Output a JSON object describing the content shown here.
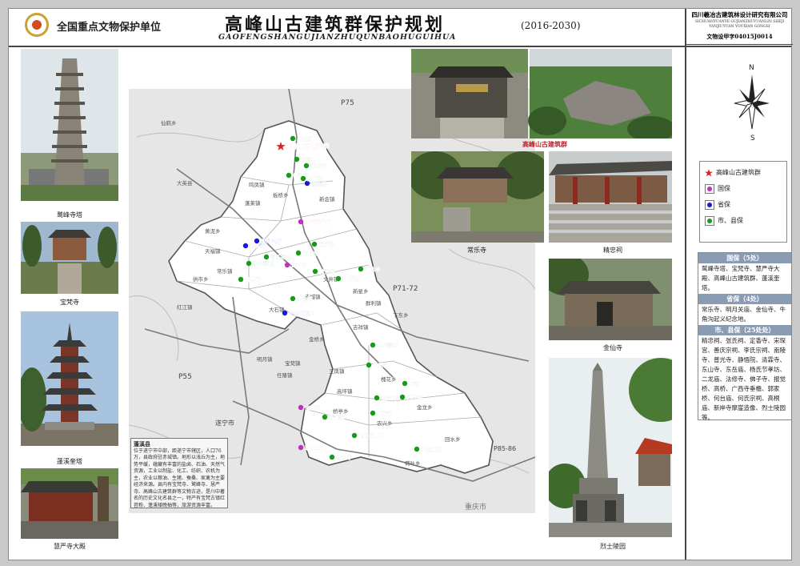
{
  "header": {
    "unit_label": "全国重点文物保护单位",
    "title": "高峰山古建筑群保护规划",
    "title_pinyin": "GAOFENGSHANGUJIANZHUQUNBAOHUGUIHUA",
    "years": "(2016-2030)"
  },
  "sidebar": {
    "org_name": "四川羲冶古建筑林设计研究有限公司",
    "org_name_en": "SICHUANYUANYE GUJIANZHUYUANLIN SHEJI YANJIUYUAN YOUXIAN GONGSI",
    "cert": "文物设甲字04015J0014",
    "compass_n": "N",
    "compass_s": "S",
    "legend": [
      {
        "label": "高峰山古建筑群",
        "color": "#e02020",
        "symbol": "star"
      },
      {
        "label": "国保",
        "color": "#c030c0",
        "symbol": "dot"
      },
      {
        "label": "省保",
        "color": "#1a1ad0",
        "symbol": "dot"
      },
      {
        "label": "市、县保",
        "color": "#1a9a1a",
        "symbol": "dot"
      }
    ],
    "lists": [
      {
        "heading": "国保（5处）",
        "body": "鹫峰寺塔、宝梵寺、慧严寺大殿、高峰山古建筑群、蓬溪奎塔。"
      },
      {
        "heading": "省保（4处）",
        "body": "常乐寺、明月关庙、金仙寺、牛角沟起义纪念地。"
      },
      {
        "heading": "市、县保（25处处）",
        "body": "精忠祠、张氏祠、定香寺、宋琛宫、善庆宗祠、李氏宗祠、南陵寺、普光寺、静悟院、清霖寺、东山寺、东岳庙、杨氏节孝坊、二龙庙、法修寺、佛子寺、报觉桥、高桥、广西寺垂檐、郭家桥、何台庙、何氏宗祠、高桐庙、新岸寺摩崖造像、烈士陵园等。"
      }
    ]
  },
  "photos": [
    {
      "name": "jiufeng-tower",
      "caption": "鹫峰寺塔"
    },
    {
      "name": "baofan-temple",
      "caption": "宝梵寺"
    },
    {
      "name": "pengxi-tower",
      "caption": "蓬溪奎塔"
    },
    {
      "name": "huiyan-hall",
      "caption": "慧严寺大殿"
    },
    {
      "name": "gaofengshan",
      "caption": "高峰山古建筑群"
    },
    {
      "name": "changle-temple",
      "caption": "常乐寺"
    },
    {
      "name": "jingzhong-shrine",
      "caption": "精忠祠"
    },
    {
      "name": "jinxian-temple",
      "caption": "金仙寺"
    },
    {
      "name": "martyrs-cemetery",
      "caption": "烈士陵园"
    }
  ],
  "map": {
    "roads": [
      "P75",
      "P71-72",
      "P55",
      "P85-86"
    ],
    "cities": [
      "遂宁市"
    ],
    "county_label": "重庆市",
    "sites": [
      {
        "name": "高峰山古建筑群",
        "level": "star"
      },
      {
        "name": "二龙庙",
        "level": "county"
      },
      {
        "name": "宋琛宫",
        "level": "county"
      },
      {
        "name": "东岳庙",
        "level": "county"
      },
      {
        "name": "佛子寺",
        "level": "county"
      },
      {
        "name": "金仙寺",
        "level": "province"
      },
      {
        "name": "法修寺",
        "level": "county"
      },
      {
        "name": "慧严寺大殿",
        "level": "national"
      },
      {
        "name": "常乐寺",
        "level": "province"
      },
      {
        "name": "明月关庙",
        "level": "province"
      },
      {
        "name": "何氏宗祠",
        "level": "county"
      },
      {
        "name": "南陵寺",
        "level": "county"
      },
      {
        "name": "东山寺",
        "level": "county"
      },
      {
        "name": "鹫峰寺",
        "level": "national"
      },
      {
        "name": "普光寺",
        "level": "county"
      },
      {
        "name": "李氏宗祠",
        "level": "county"
      },
      {
        "name": "清霖寺",
        "level": "county"
      },
      {
        "name": "广西寺",
        "level": "county"
      },
      {
        "name": "静悟院",
        "level": "county"
      },
      {
        "name": "精忠祠",
        "level": "county"
      },
      {
        "name": "牛角沟起义",
        "level": "province"
      },
      {
        "name": "善庆宗祠",
        "level": "county"
      },
      {
        "name": "报觉桥",
        "level": "county"
      },
      {
        "name": "高桥",
        "level": "county"
      },
      {
        "name": "何台庙",
        "level": "county"
      },
      {
        "name": "张氏祠",
        "level": "county"
      },
      {
        "name": "宝梵寺",
        "level": "national"
      },
      {
        "name": "郭家桥",
        "level": "county"
      },
      {
        "name": "蓬溪奎塔",
        "level": "national"
      },
      {
        "name": "高桐庙",
        "level": "county"
      },
      {
        "name": "烈士陵园",
        "level": "county"
      },
      {
        "name": "定香寺",
        "level": "county"
      },
      {
        "name": "新岸寺摩崖",
        "level": "county"
      }
    ],
    "towns": [
      "仙鹤乡",
      "大英县",
      "蓬莱镇",
      "板桥乡",
      "新会镇",
      "鸣凤镇",
      "赤城镇",
      "文井镇",
      "群利镇",
      "大石镇",
      "天福镇",
      "常乐镇",
      "红江镇",
      "金桥乡",
      "吉祥镇",
      "宝梵镇",
      "明月镇",
      "任隆镇",
      "三凤镇",
      "农兴乡",
      "高坪镇",
      "槐花乡",
      "金龙乡",
      "回水乡",
      "荷叶乡",
      "拱市乡",
      "下东乡",
      "新星乡",
      "黄泥乡",
      "桥亭乡"
    ],
    "intro_title": "蓬溪县",
    "intro_text": "位于遂宁市中部，距遂宁市辖区，人口76万，县政府驻赤城镇。地形以浅丘为主，地势平缓，蕴藏有丰富的盐卤、石油、天然气资源，工业以制盐、化工、纺织、农机为主，农业以粮油、生猪、蚕桑、家禽为主要经济来源。县内有宝梵寺、鹫峰寺、慧严寺、高峰山古建筑群等文物古迹，是川中著名的历史文化名县之一，特产有宝梵古镇红苕粉、蓬溪矮晚柚等，旅游资源丰富。"
  }
}
